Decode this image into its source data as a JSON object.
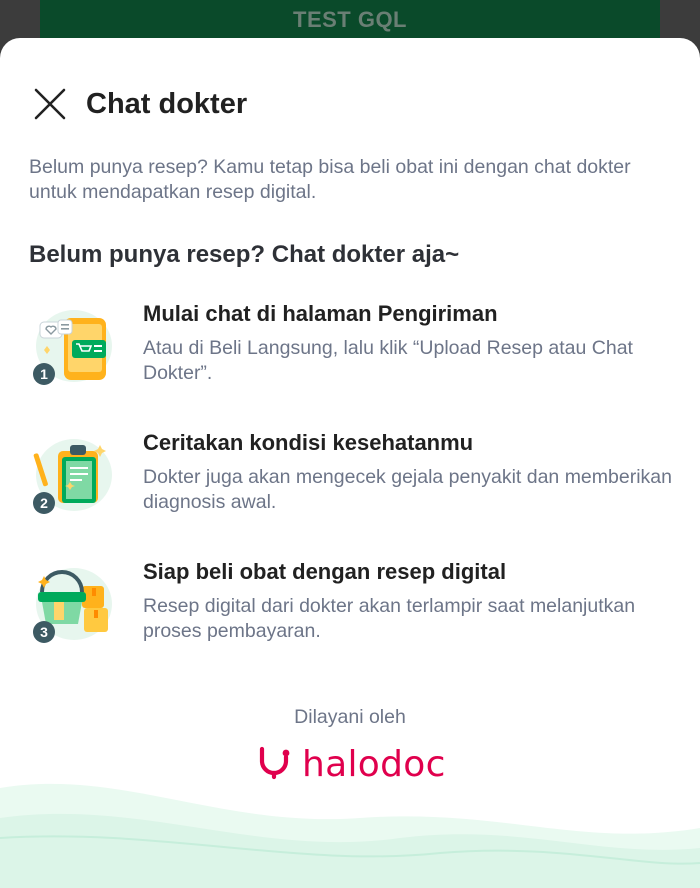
{
  "backdrop": {
    "banner_label": "TEST GQL"
  },
  "sheet": {
    "title": "Chat dokter",
    "intro": "Belum punya resep? Kamu tetap bisa beli obat ini dengan chat dokter untuk mendapatkan resep digital.",
    "subheading": "Belum punya resep? Chat dokter aja~",
    "steps": [
      {
        "number": "1",
        "title": "Mulai chat di halaman Pengiriman",
        "desc": "Atau di Beli Langsung, lalu klik “Upload Resep atau Chat Dokter”.",
        "icon": "phone-shopping-icon"
      },
      {
        "number": "2",
        "title": "Ceritakan kondisi kesehatanmu",
        "desc": "Dokter juga akan mengecek gejala penyakit dan memberikan diagnosis awal.",
        "icon": "clipboard-icon"
      },
      {
        "number": "3",
        "title": "Siap beli obat dengan resep digital",
        "desc": "Resep digital dari dokter akan terlampir saat melanjutkan proses pembayaran.",
        "icon": "basket-icon"
      }
    ],
    "footer_label": "Dilayani oleh",
    "brand_name": "halodoc"
  },
  "colors": {
    "brand": "#e0004d",
    "accent_green": "#03ac0e",
    "text_primary": "#212121",
    "text_secondary": "#6d7588",
    "badge": "#3d5a63"
  }
}
